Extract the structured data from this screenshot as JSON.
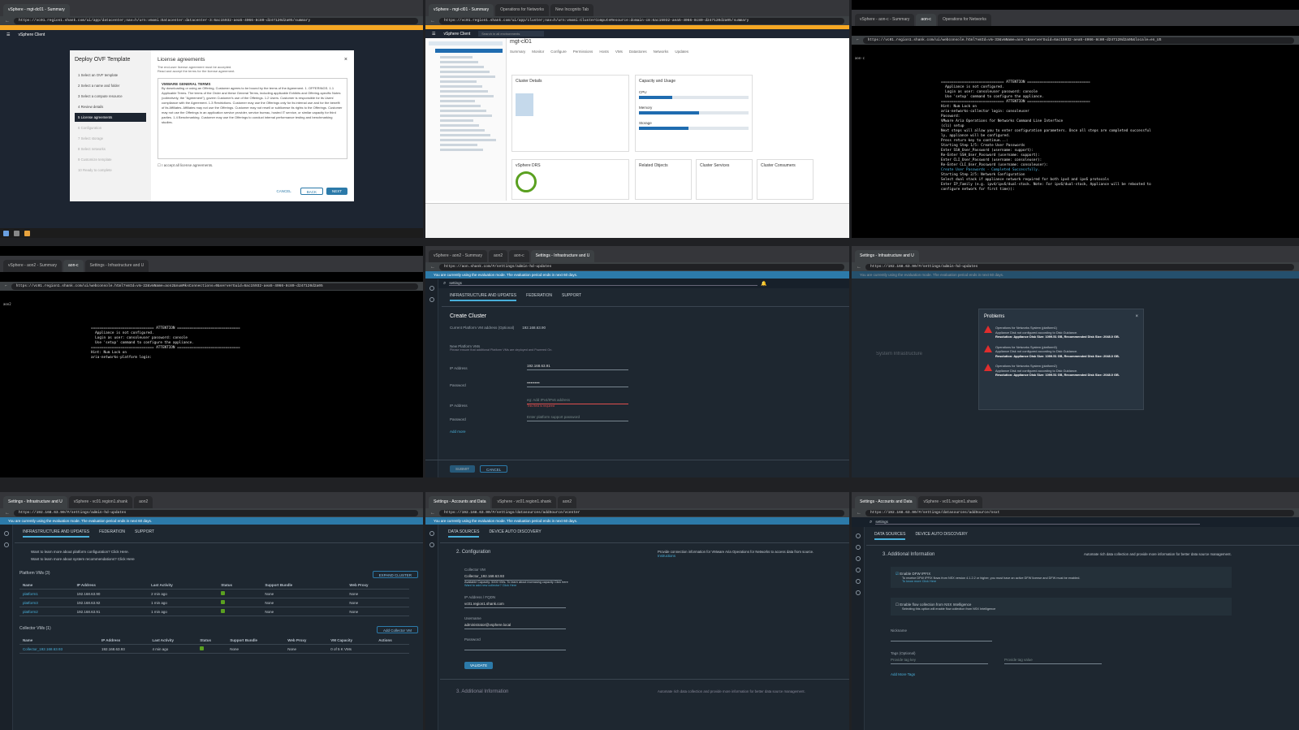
{
  "p1": {
    "tabs": [
      "vSphere - mgt-dc01 - Summary"
    ],
    "url": "https://vc01.region1.shank.com/ui/app/datacenter;nav=h/urn:vmomi:Datacenter:datacenter-3:6ac15932-aea5-4066-8c80-d247120d2a05/summary",
    "app": "vSphere Client",
    "wizard_title": "Deploy OVF Template",
    "steps": [
      "1 Select an OVF template",
      "2 Select a name and folder",
      "3 Select a compute resource",
      "4 Review details",
      "5 License agreements",
      "6 Configuration",
      "7 Select storage",
      "8 Select networks",
      "9 Customize template",
      "10 Ready to complete"
    ],
    "active_step": 4,
    "section_title": "License agreements",
    "section_sub": "The end-user license agreement must be accepted.",
    "section_sub2": "Read and accept the terms for the license agreement.",
    "eula_heading": "VMWARE GENERAL TERMS",
    "eula_text": "By downloading or using an Offering, Customer agrees to be bound by the terms of the Agreement. 1. OFFERINGS. 1.1 Applicable Terms. The terms of the Order and these General Terms, including applicable Exhibits and Offering-specific Notes (collectively, the \"Agreement\"), govern Customer's use of the Offerings. 1.2 Users. Customer is responsible for its Users' compliance with the Agreement. 1.3 Restrictions. Customer may use the Offerings only for its internal use and for the benefit of its Affiliates. Affiliates may not use the Offerings. Customer may not resell or sublicense its rights to the Offerings. Customer may not use the Offerings in an application service provider, service bureau, hosted IT service, or similar capacity for third parties. 1.4 Benchmarking. Customer may use the Offerings to conduct internal performance testing and benchmarking studies.",
    "accept": "I accept all license agreements.",
    "cancel": "CANCEL",
    "back": "BACK",
    "next": "NEXT"
  },
  "p2": {
    "tabs": [
      "vSphere - mgt-cl01 - Summary",
      "Operations for Networks",
      "New Incognito Tab"
    ],
    "url": "https://vc01.region1.shank.com/ui/app/cluster;nav=h/urn:vmomi:ClusterComputeResource:domain-c8:6ac15932-aea5-4066-8c80-d247120d2a05/summary",
    "app": "vSphere Client",
    "search": "Search in all environments",
    "object": "mgt-cl01",
    "tabs2": [
      "Summary",
      "Monitor",
      "Configure",
      "Permissions",
      "Hosts",
      "VMs",
      "Datastores",
      "Networks",
      "Updates"
    ],
    "card1": "Cluster Details",
    "card2": "Capacity and Usage",
    "cap": [
      "CPU",
      "Memory",
      "Storage"
    ],
    "card3": "vSphere DRS",
    "card4": "Related Objects",
    "card5": "Cluster Services",
    "card6": "Cluster Consumers"
  },
  "p3": {
    "tabs": [
      "vSphere - aon-c - Summary",
      "aon-c",
      "Operations for Networks"
    ],
    "url": "https://vc01.region1.shank.com/ui/webconsole.html?vmId=vm-33&vmName=aon-c&serverGuid=6ac15932-aea5-4066-8c80-d247120d2a05&locale=en_US",
    "vm": "aon-c",
    "lines": [
      "============================== ATTENTION ==============================",
      "  Appliance is not configured.",
      "  Login as user: consoleuser password: console",
      "  Use 'setup' command to configure the appliance.",
      "============================== ATTENTION ==============================",
      "",
      "Hint: Num Lock on",
      "",
      "aria-networks-collector login: consoleuser",
      "Password:",
      "VMware Aria Operations for Networks Command Line Interface",
      "(cli) setup",
      "",
      "Next steps will allow you to enter configuration parameters. Once all steps are completed successful",
      "ly, appliance will be configured.",
      "",
      "Press return key to continue...:",
      "",
      "Starting Step 1/5: Create User Passwords",
      "",
      "Enter SSH_User_Password (username: support):",
      "Re-Enter SSH_User_Password (username: support):",
      "Enter CLI_User_Password (username: consoleuser):",
      "Re-Enter CLI_User_Password (username: consoleuser):",
      "",
      "Create User Passwords - Completed Successfully.",
      "",
      "Starting Step 2/5: Network Configuration",
      "",
      "Select dual stack if appliance network required for both ipv4 and ipv6 protocols",
      "",
      "Enter IP_Family (e.g. ipv4/ipv6/dual-stack. Note: For ipv6/dual-stack, Appliance will be rebooted to",
      "configure network for first time)):"
    ]
  },
  "p4": {
    "tabs": [
      "vSphere - aon2 - Summary",
      "aon-c",
      "Settings - Infrastructure and U"
    ],
    "url": "https://vc01.region1.shank.com/ui/webconsole.html?vmId=vm-22&vmName=aon2&numMksConnections=0&serverGuid=6ac15932-aea5-4066-8c80-d247120d2a05",
    "vm": "aon2",
    "lines": [
      "============================== ATTENTION ==============================",
      "  Appliance is not configured.",
      "  Login as user: consoleuser password: console",
      "  Use 'setup' command to configure the appliance.",
      "============================== ATTENTION ==============================",
      "",
      "Hint: Num Lock on",
      "",
      "aria-networks-platform login:"
    ]
  },
  "p5": {
    "tabs": [
      "vSphere - aon2 - Summary",
      "aon2",
      "aon-c",
      "Settings - Infrastructure and U"
    ],
    "url": "https://aon.shank.com/#/settings/admin-hd-updates",
    "eval": "You are currently using the evaluation mode. The evaluation period ends in next 60 days.",
    "search": "settings",
    "nav": [
      "INFRASTRUCTURE AND UPDATES",
      "FEDERATION",
      "SUPPORT"
    ],
    "title": "Create Cluster",
    "current_lbl": "Current Platform VM address (Optional)",
    "current_ip": "192.168.63.90",
    "new_lbl": "New Platform VMs",
    "new_note": "Please ensure that additional Platform VMs are deployed and Powered On.",
    "ip_lbl": "IP Address",
    "ip1": "192.168.63.91",
    "pw_lbl": "Password",
    "pw1": "••••••••••",
    "ip2_ph": "eg: Add IPv4/IPv6 address",
    "ip2_err": "This field is required",
    "pw2_ph": "Enter platform support password",
    "add_more": "Add more",
    "submit": "SUBMIT",
    "cancel": "CANCEL"
  },
  "p6": {
    "tabs": [
      "Settings - Infrastructure and U"
    ],
    "url": "https://192.168.63.90/#/settings/admin-hd-updates",
    "eval": "You are currently using the evaluation mode. The evaluation period ends in next 60 days.",
    "dialog_title": "Problems",
    "problems": [
      {
        "name": "Operations for Networks System (platform1)",
        "msg": "Appliance Disk not configured according to Disk Guidance.",
        "res": "Resolution: Appliance Disk Size: 1099.51 GB, Recommended Disk Size: 2048.0 GB."
      },
      {
        "name": "Operations for Networks System (platform3)",
        "msg": "Appliance Disk not configured according to Disk Guidance.",
        "res": "Resolution: Appliance Disk Size: 1099.51 GB, Recommended Disk Size: 2048.0 GB."
      },
      {
        "name": "Operations for Networks System (platform2)",
        "msg": "Appliance Disk not configured according to Disk Guidance.",
        "res": "Resolution: Appliance Disk Size: 1099.51 GB, Recommended Disk Size: 2048.0 GB."
      }
    ],
    "bg_section": "System Infrastructure"
  },
  "p7": {
    "tabs": [
      "Settings - Infrastructure and U",
      "vSphere - vc01.region1.shank",
      "aon2"
    ],
    "url": "https://192.168.63.90/#/settings/admin-hd-updates",
    "eval": "You are currently using the evaluation mode. The evaluation period ends in next 60 days.",
    "nav": [
      "INFRASTRUCTURE AND UPDATES",
      "FEDERATION",
      "SUPPORT"
    ],
    "learn1": "Want to learn more about platform configuration? Click Here.",
    "learn2": "Want to learn more about system recommendations? Click Here",
    "platform_hdr": "Platform VMs (3)",
    "expand": "EXPAND CLUSTER",
    "cols": [
      "Name",
      "IP Address",
      "Last Activity",
      "Status",
      "Support Bundle",
      "Web Proxy"
    ],
    "platform_rows": [
      [
        "platform1",
        "192.168.63.90",
        "2 min ago",
        "",
        "None",
        "None"
      ],
      [
        "platform3",
        "192.168.63.92",
        "1 min ago",
        "",
        "None",
        "None"
      ],
      [
        "platform2",
        "192.168.63.91",
        "1 min ago",
        "",
        "None",
        "None"
      ]
    ],
    "collector_hdr": "Collector VMs (1)",
    "add_collector": "Add Collector VM",
    "ccols": [
      "Name",
      "IP Address",
      "Last Activity",
      "Status",
      "Support Bundle",
      "Web Proxy",
      "VM Capacity",
      "Actions"
    ],
    "collector_rows": [
      [
        "Collector_192.168.63.93",
        "192.168.63.93",
        "4 min ago",
        "",
        "None",
        "None",
        "0 of 5 K VMs",
        ""
      ]
    ]
  },
  "p8": {
    "tabs": [
      "Settings - Accounts and Data",
      "vSphere - vc01.region1.shank",
      "aon2"
    ],
    "url": "https://192.168.63.90/#/settings/datasources/addSource/vcenter",
    "eval": "You are currently using the evaluation mode. The evaluation period ends in next 60 days.",
    "nav": [
      "DATA SOURCES",
      "DEVICE AUTO DISCOVERY"
    ],
    "step": "2.",
    "step_title": "Configuration",
    "desc": "Provide connection information for VMware Aria Operations for Networks to access data from source.",
    "instructions": "Instructions",
    "collector_lbl": "Collector VM",
    "collector_val": "Collector_192.168.63.93",
    "capacity": "Available Capacity: 5000 VMs. To learn about increasing capacity Click here",
    "add_new": "Want to add new collector? Click Here",
    "fqdn_lbl": "IP Address / FQDN",
    "fqdn_val": "vc01.region1.shank.com",
    "user_lbl": "Username",
    "user_val": "administrator@vsphere.local",
    "pass_lbl": "Password",
    "validate": "VALIDATE",
    "step3": "3.",
    "step3_title": "Additional Information",
    "step3_desc": "Automate rich data collection and provide more information for better data source management."
  },
  "p9": {
    "tabs": [
      "Settings - Accounts and Data",
      "vSphere - vc01.region1.shank"
    ],
    "url": "https://192.168.63.90/#/settings/datasources/addSource/nsxt",
    "search": "settings",
    "nav": [
      "DATA SOURCES",
      "DEVICE AUTO DISCOVERY"
    ],
    "step": "3.",
    "step_title": "Additional Information",
    "desc": "Automate rich data collection and provide more information for better data source management.",
    "dfw": "Enable DFW IPFIX",
    "dfw_note": "To receive DFW IPFIX flows from NSX version 4.1.2.2 or higher, you must have an active DFW license and DFW must be enabled.",
    "know_more": "To know more Click Here",
    "nsx": "Enable flow collection from NSX Intelligence",
    "nsx_note": "Selecting this option will enable flow collection from NSX Intelligence",
    "nick_lbl": "Nickname",
    "tags_lbl": "Tags (Optional)",
    "tag_key": "Provide tag key",
    "tag_val": "Provide tag value",
    "add_tags": "Add More Tags"
  }
}
